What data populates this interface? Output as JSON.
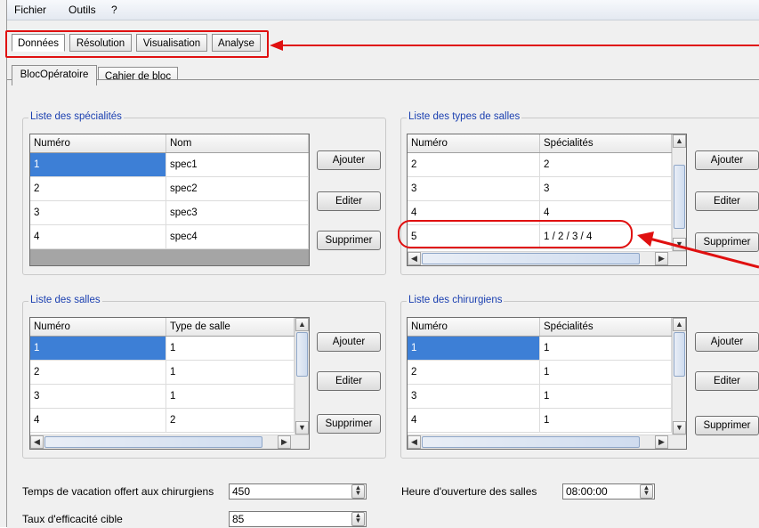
{
  "menu": {
    "items": [
      "Fichier",
      "Outils",
      "?"
    ]
  },
  "main_tabs": [
    "Données",
    "Résolution",
    "Visualisation",
    "Analyse"
  ],
  "sub_tabs": [
    "BlocOpératoire",
    "Cahier de bloc"
  ],
  "groups": {
    "specialites": {
      "title": "Liste des spécialités",
      "columns": [
        "Numéro",
        "Nom"
      ],
      "rows": [
        [
          "1",
          "spec1"
        ],
        [
          "2",
          "spec2"
        ],
        [
          "3",
          "spec3"
        ],
        [
          "4",
          "spec4"
        ]
      ]
    },
    "types_salles": {
      "title": "Liste des types de salles",
      "columns": [
        "Numéro",
        "Spécialités"
      ],
      "rows": [
        [
          "2",
          "2"
        ],
        [
          "3",
          "3"
        ],
        [
          "4",
          "4"
        ],
        [
          "5",
          "1 / 2 / 3 / 4"
        ]
      ]
    },
    "salles": {
      "title": "Liste des salles",
      "columns": [
        "Numéro",
        "Type de salle"
      ],
      "rows": [
        [
          "1",
          "1"
        ],
        [
          "2",
          "1"
        ],
        [
          "3",
          "1"
        ],
        [
          "4",
          "2"
        ]
      ]
    },
    "chirurgiens": {
      "title": "Liste des chirurgiens",
      "columns": [
        "Numéro",
        "Spécialités"
      ],
      "rows": [
        [
          "1",
          "1"
        ],
        [
          "2",
          "1"
        ],
        [
          "3",
          "1"
        ],
        [
          "4",
          "1"
        ]
      ]
    }
  },
  "buttons": {
    "add": "Ajouter",
    "edit": "Editer",
    "delete": "Supprimer"
  },
  "fields": {
    "vacation_label": "Temps de vacation offert aux chirurgiens",
    "vacation_value": "450",
    "efficacite_label": "Taux d'efficacité cible",
    "efficacite_value": "85",
    "ouverture_label": "Heure d'ouverture des salles",
    "ouverture_value": "08:00:00"
  },
  "colors": {
    "highlight": "#e01010",
    "selection": "#3d7fd6",
    "group_title": "#1a3fb0"
  },
  "icons": [
    "scroll-up-icon",
    "scroll-down-icon",
    "scroll-left-icon",
    "scroll-right-icon",
    "spin-up-down-icon",
    "annotation-arrow-icon"
  ]
}
